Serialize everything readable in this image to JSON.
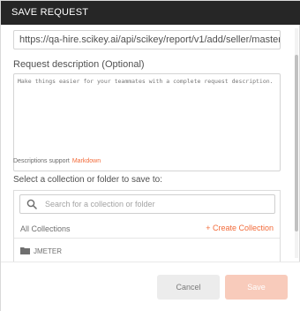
{
  "dialog": {
    "title": "SAVE REQUEST"
  },
  "request": {
    "url": "https://qa-hire.scikey.ai/api/scikey/report/v1/add/seller/master",
    "description_label": "Request description (Optional)",
    "description_placeholder": "Make things easier for your teammates with a complete request description.",
    "description_support_text": "Descriptions support",
    "markdown_link": "Markdown"
  },
  "collections": {
    "save_to_label": "Select a collection or folder to save to:",
    "search_placeholder": "Search for a collection or folder",
    "all_collections_label": "All Collections",
    "create_collection_label": "+ Create Collection",
    "items": [
      {
        "name": "JMETER",
        "icon": "folder-icon"
      }
    ]
  },
  "footer": {
    "cancel_label": "Cancel",
    "save_label": "Save"
  },
  "colors": {
    "titlebar": "#262626",
    "accent": "#f26b3a",
    "save_disabled": "#f8cbbb",
    "cancel_bg": "#ececec"
  }
}
